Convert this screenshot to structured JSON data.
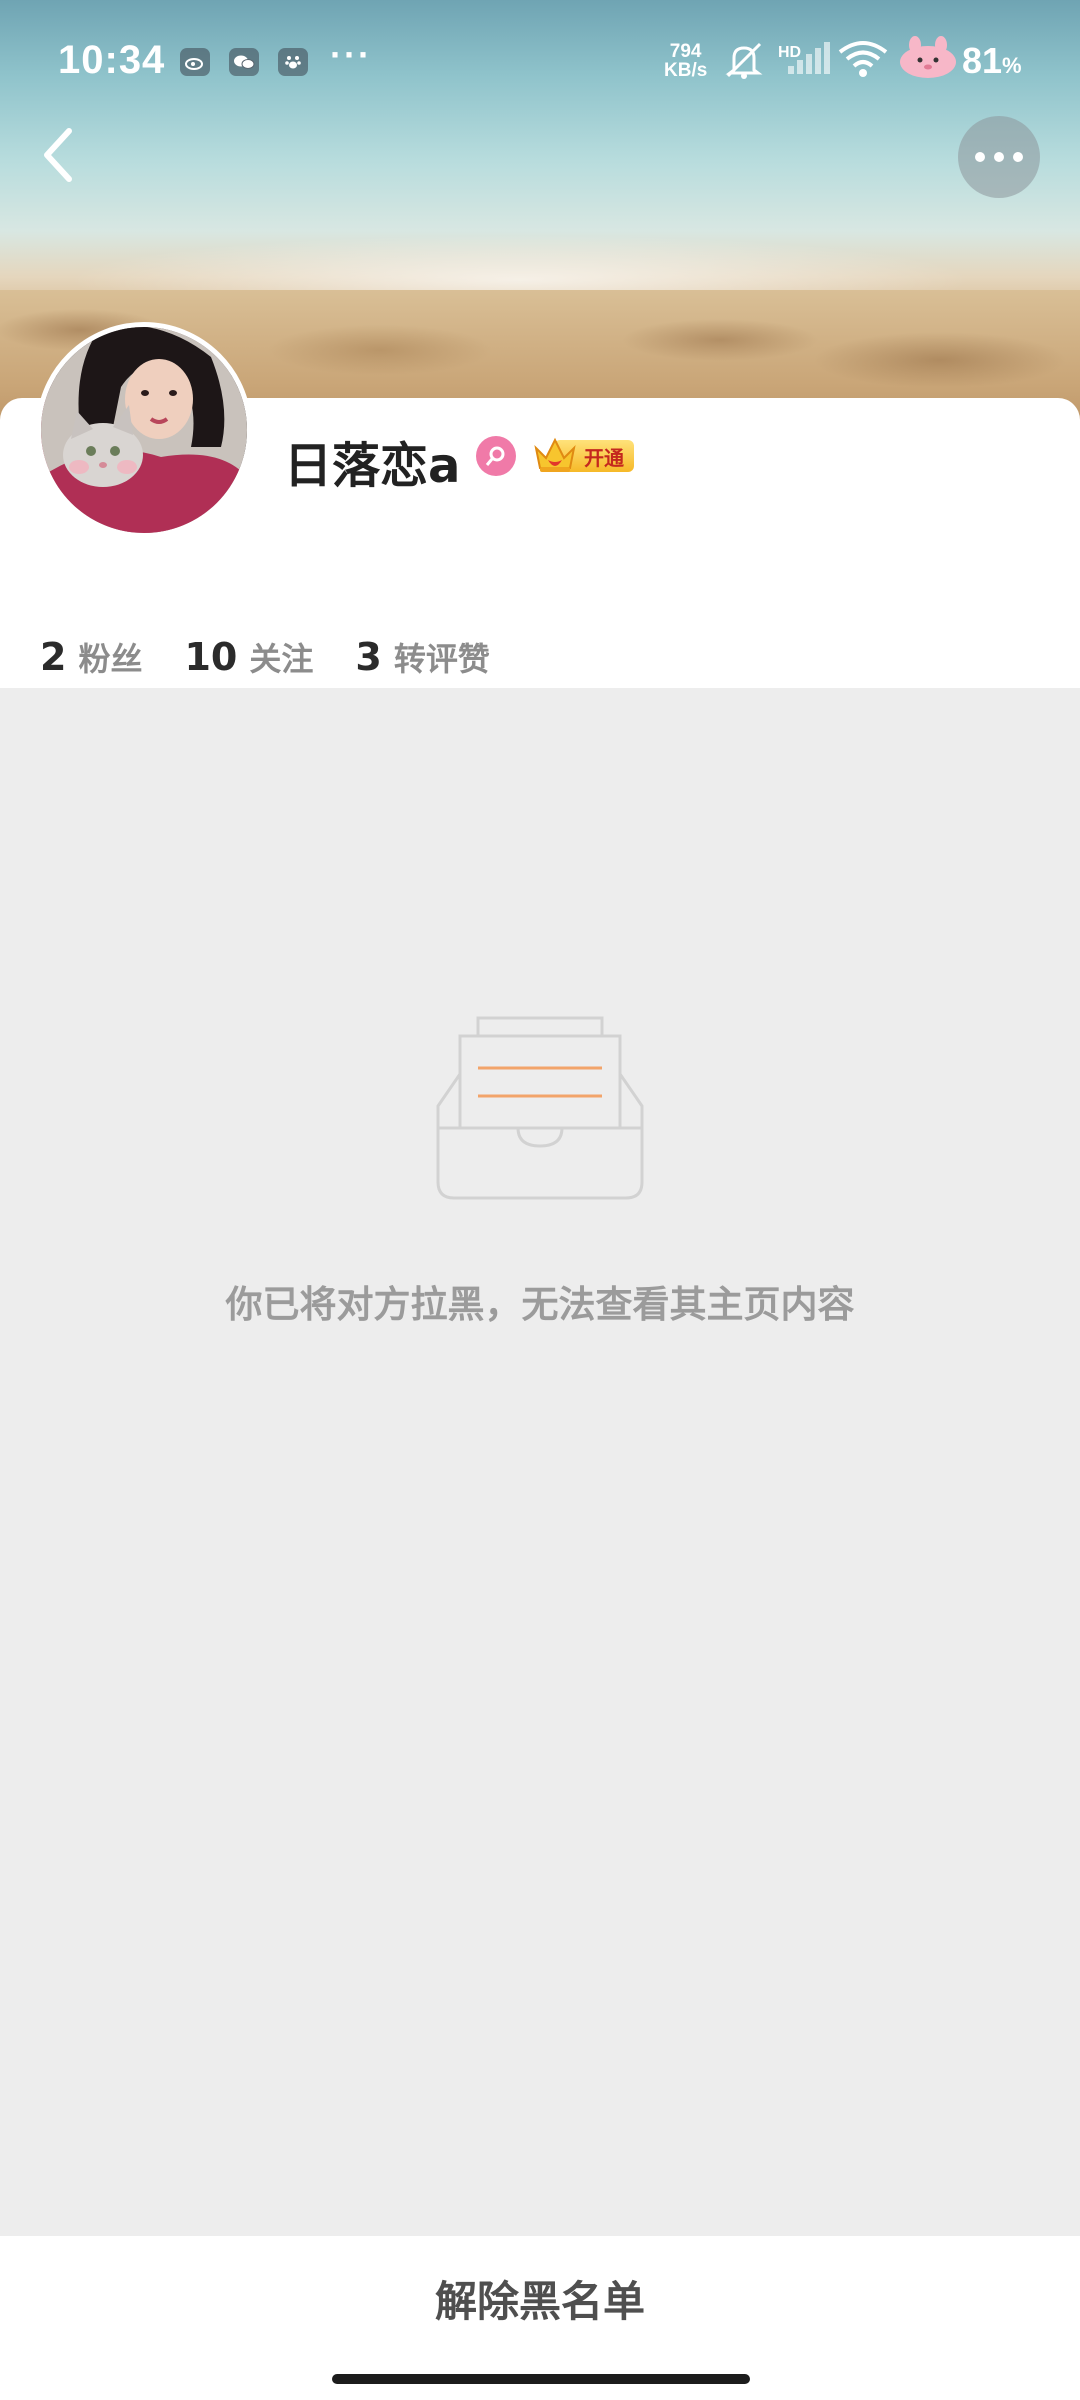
{
  "status_bar": {
    "time": "10:34",
    "net_speed_value": "794",
    "net_speed_unit": "KB/s",
    "battery_percent": "81",
    "battery_unit": "%",
    "hd_label": "HD",
    "overflow_dots": "···",
    "icons": [
      "weibo-icon",
      "wechat-icon",
      "paw-icon",
      "mute-icon",
      "signal-icon",
      "wifi-icon",
      "battery-icon"
    ]
  },
  "profile": {
    "username": "日落恋a",
    "vip_label": "开通",
    "stats": [
      {
        "value": "2",
        "label": "粉丝"
      },
      {
        "value": "10",
        "label": "关注"
      },
      {
        "value": "3",
        "label": "转评赞"
      }
    ]
  },
  "empty_state": {
    "message": "你已将对方拉黑，无法查看其主页内容"
  },
  "bottom": {
    "unblock_label": "解除黑名单"
  },
  "colors": {
    "background": "#ededed",
    "gender_badge": "#f07aa8",
    "vip_gold": "#f6b928",
    "illustration_line": "#f2a46a"
  }
}
